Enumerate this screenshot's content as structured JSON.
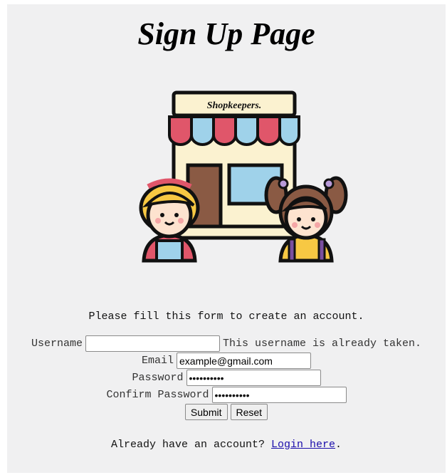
{
  "page": {
    "title": "Sign Up Page",
    "logo_text": "Shopkeepers."
  },
  "form": {
    "instruction": "Please fill this form to create an account.",
    "username_label": "Username",
    "username_value": "",
    "username_error": "This username is already taken.",
    "email_label": "Email",
    "email_value": "example@gmail.com",
    "password_label": "Password",
    "password_value": "••••••••••",
    "confirm_label": "Confirm Password",
    "confirm_value": "••••••••••",
    "submit_label": "Submit",
    "reset_label": "Reset"
  },
  "footer": {
    "prompt": "Already have an account?",
    "login_link": "Login here",
    "period": "."
  },
  "colors": {
    "background": "#f0f0f1",
    "link": "#1a0dab",
    "awning_red": "#e0566a",
    "awning_blue": "#9fd2ea"
  },
  "icons": [
    "shop-illustration"
  ]
}
